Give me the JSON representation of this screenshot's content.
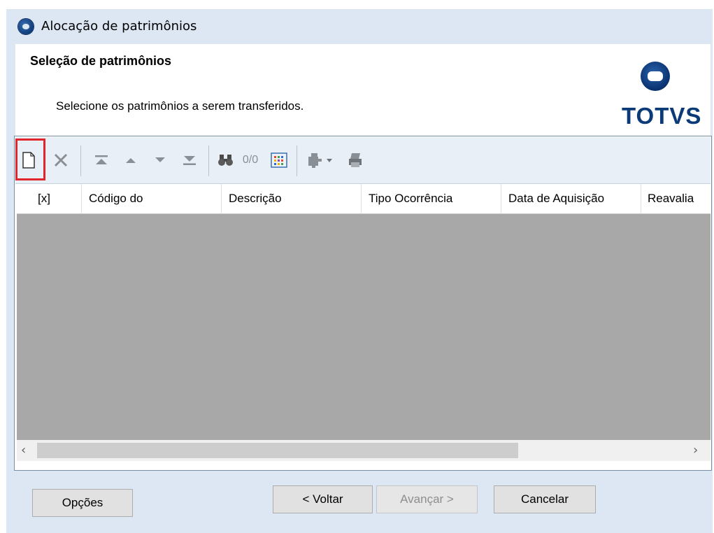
{
  "window": {
    "title": "Alocação de patrimônios"
  },
  "header": {
    "title": "Seleção de patrimônios",
    "subtitle": "Selecione os patrimônios a serem transferidos.",
    "logo_text": "TOTVS"
  },
  "toolbar": {
    "counter": "0/0",
    "icons": [
      "new-document-icon",
      "delete-icon",
      "first-record-icon",
      "previous-record-icon",
      "next-record-icon",
      "last-record-icon",
      "find-icon",
      "grid-settings-icon",
      "process-dropdown-icon",
      "print-icon"
    ]
  },
  "grid": {
    "columns": [
      "[x]",
      "Código do",
      "Descrição",
      "Tipo Ocorrência",
      "Data de Aquisição",
      "Reavalia"
    ],
    "rows": []
  },
  "buttons": {
    "options": "Opções",
    "back": "< Voltar",
    "next": "Avançar >",
    "cancel": "Cancelar"
  },
  "colors": {
    "highlight": "#e0262c",
    "brand": "#0b3a79"
  }
}
